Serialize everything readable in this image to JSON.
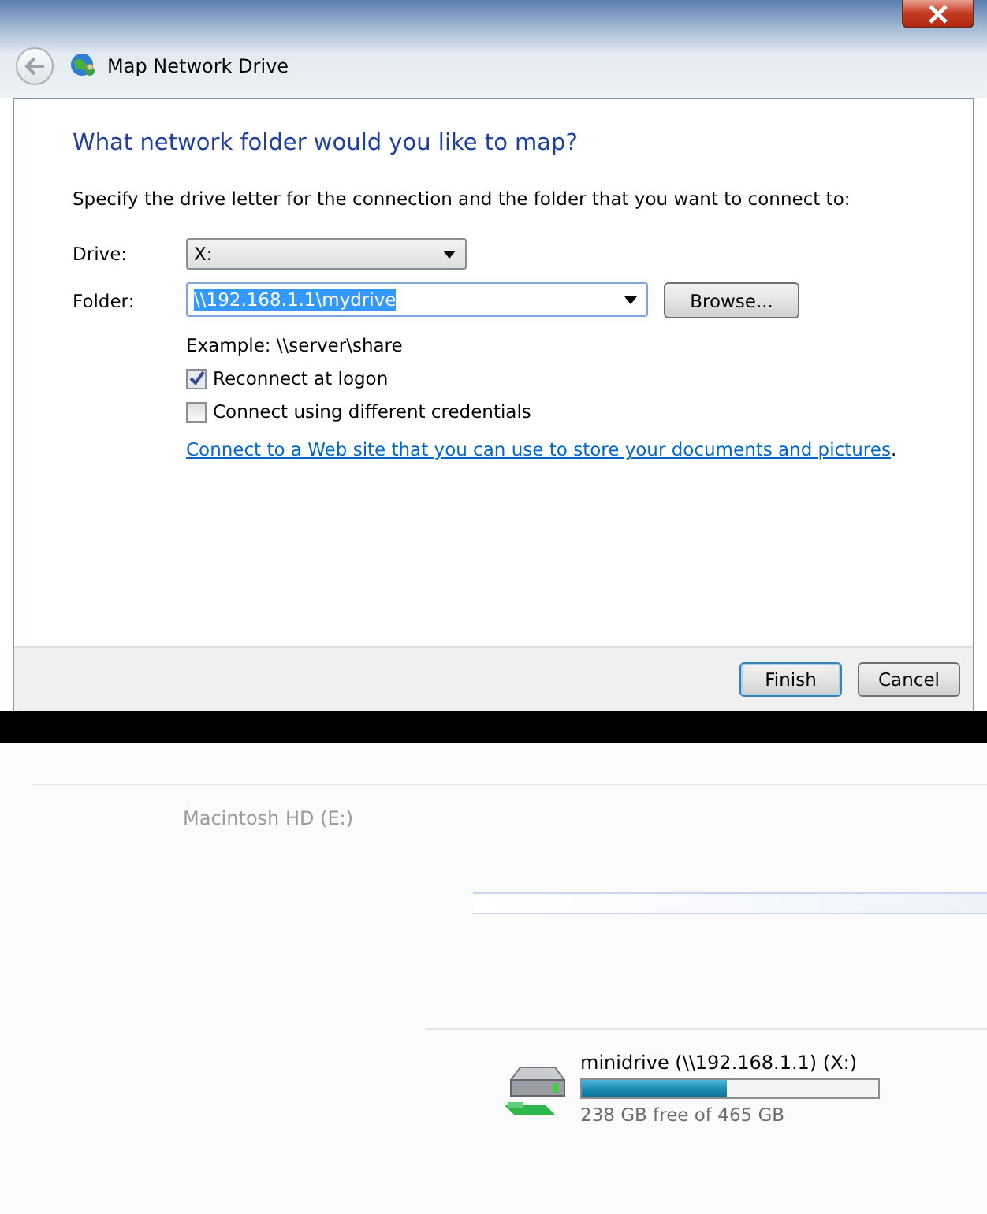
{
  "window": {
    "title": "Map Network Drive"
  },
  "heading": "What network folder would you like to map?",
  "instruction": "Specify the drive letter for the connection and the folder that you want to connect to:",
  "drive": {
    "label": "Drive:",
    "value": "X:"
  },
  "folder": {
    "label": "Folder:",
    "value": "\\\\192.168.1.1\\mydrive",
    "selected": true
  },
  "browse_button": "Browse...",
  "example": "Example: \\\\server\\share",
  "options": [
    {
      "label": "Reconnect at logon",
      "checked": true
    },
    {
      "label": "Connect using different credentials",
      "checked": false
    }
  ],
  "link": "Connect to a Web site that you can use to store your documents and pictures",
  "link_suffix": ".",
  "buttons": [
    {
      "label": "Finish",
      "selected": true
    },
    {
      "label": "Cancel",
      "selected": false
    }
  ],
  "explorer": {
    "faded_drive": "Macintosh HD (E:)",
    "drive": {
      "name": "minidrive (\\\\192.168.1.1) (X:)",
      "level": 0.49,
      "free": "238 GB free of 465 GB"
    }
  }
}
